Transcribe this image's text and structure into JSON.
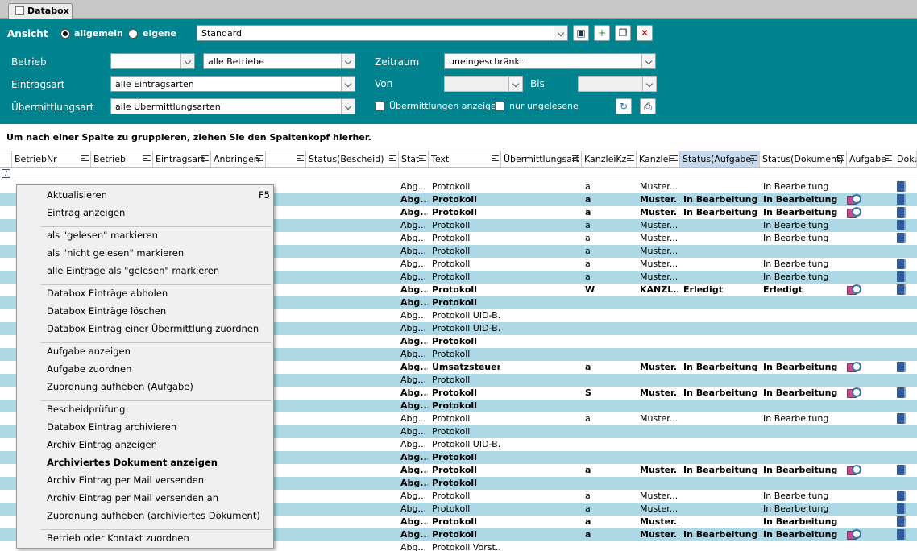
{
  "tab": {
    "title": "Databox"
  },
  "ansicht": {
    "label": "Ansicht",
    "opt1": "allgemein",
    "opt2": "eigene",
    "view": "Standard"
  },
  "filters": {
    "betrieb_label": "Betrieb",
    "betrieb_value": "",
    "betrieb_all": "alle Betriebe",
    "eintragsart_label": "Eintragsart",
    "eintragsart_value": "alle Eintragsarten",
    "uebermittlungsart_label": "Übermittlungsart",
    "uebermittlungsart_value": "alle Übermittlungsarten",
    "zeitraum_label": "Zeitraum",
    "zeitraum_value": "uneingeschränkt",
    "von_label": "Von",
    "bis_label": "Bis",
    "show_uebermittlungen": "Übermittlungen anzeigen",
    "nur_ungelesene": "nur ungelesene"
  },
  "group_hint": "Um nach einer Spalte zu gruppieren, ziehen Sie den Spaltenkopf hierher.",
  "columns": [
    "BetriebNr",
    "Betrieb",
    "Eintragsart",
    "Anbringen",
    "",
    "Status(Bescheid)",
    "Stat",
    "Text",
    "Übermittlungsart",
    "KanzleiKz",
    "Kanzlei",
    "Status(Aufgabe)",
    "Status(Dokument)",
    "Aufgabe",
    "Doku"
  ],
  "rows": [
    {
      "b": false,
      "alt": false,
      "stat": "Abg...",
      "text": "Protokoll",
      "kz": "a",
      "kanzlei": "Muster...",
      "aufg": "",
      "dok": "In Bearbeitung",
      "task": false,
      "doc": true
    },
    {
      "b": true,
      "alt": true,
      "stat": "Abg...",
      "text": "Protokoll",
      "kz": "a",
      "kanzlei": "Muster...",
      "aufg": "In Bearbeitung",
      "dok": "In Bearbeitung",
      "task": true,
      "doc": true
    },
    {
      "b": true,
      "alt": false,
      "stat": "Abg...",
      "text": "Protokoll",
      "kz": "a",
      "kanzlei": "Muster...",
      "aufg": "In Bearbeitung",
      "dok": "In Bearbeitung",
      "task": true,
      "doc": true
    },
    {
      "b": false,
      "alt": true,
      "stat": "Abg...",
      "text": "Protokoll",
      "kz": "a",
      "kanzlei": "Muster...",
      "aufg": "",
      "dok": "In Bearbeitung",
      "task": false,
      "doc": true
    },
    {
      "b": false,
      "alt": false,
      "stat": "Abg...",
      "text": "Protokoll",
      "kz": "a",
      "kanzlei": "Muster...",
      "aufg": "",
      "dok": "In Bearbeitung",
      "task": false,
      "doc": true
    },
    {
      "b": false,
      "alt": true,
      "stat": "Abg...",
      "text": "Protokoll",
      "kz": "a",
      "kanzlei": "Muster...",
      "aufg": "",
      "dok": "",
      "task": false,
      "doc": false
    },
    {
      "b": false,
      "alt": false,
      "stat": "Abg...",
      "text": "Protokoll",
      "kz": "a",
      "kanzlei": "Muster...",
      "aufg": "",
      "dok": "In Bearbeitung",
      "task": false,
      "doc": true
    },
    {
      "b": false,
      "alt": true,
      "stat": "Abg...",
      "text": "Protokoll",
      "kz": "a",
      "kanzlei": "Muster...",
      "aufg": "",
      "dok": "In Bearbeitung",
      "task": false,
      "doc": true
    },
    {
      "b": true,
      "alt": false,
      "stat": "Abg...",
      "text": "Protokoll",
      "kz": "W",
      "kanzlei": "KANZL...",
      "aufg": "Erledigt",
      "dok": "Erledigt",
      "task": true,
      "doc": true
    },
    {
      "b": true,
      "alt": true,
      "stat": "Abg...",
      "text": "Protokoll",
      "kz": "",
      "kanzlei": "",
      "aufg": "",
      "dok": "",
      "task": false,
      "doc": false
    },
    {
      "b": false,
      "alt": false,
      "stat": "Abg...",
      "text": "Protokoll UID-B...",
      "kz": "",
      "kanzlei": "",
      "aufg": "",
      "dok": "",
      "task": false,
      "doc": false
    },
    {
      "b": false,
      "alt": true,
      "stat": "Abg...",
      "text": "Protokoll UID-B...",
      "kz": "",
      "kanzlei": "",
      "aufg": "",
      "dok": "",
      "task": false,
      "doc": false
    },
    {
      "b": true,
      "alt": false,
      "stat": "Abg...",
      "text": "Protokoll",
      "kz": "",
      "kanzlei": "",
      "aufg": "",
      "dok": "",
      "task": false,
      "doc": false
    },
    {
      "b": false,
      "alt": true,
      "stat": "Abg...",
      "text": "Protokoll",
      "kz": "",
      "kanzlei": "",
      "aufg": "",
      "dok": "",
      "task": false,
      "doc": false
    },
    {
      "b": true,
      "alt": false,
      "stat": "Abg...",
      "text": "Umsatzsteuer...",
      "kz": "a",
      "kanzlei": "Muster...",
      "aufg": "In Bearbeitung",
      "dok": "In Bearbeitung",
      "task": true,
      "doc": true
    },
    {
      "b": false,
      "alt": true,
      "stat": "Abg...",
      "text": "Protokoll",
      "kz": "",
      "kanzlei": "",
      "aufg": "",
      "dok": "",
      "task": false,
      "doc": false
    },
    {
      "b": true,
      "alt": false,
      "stat": "Abg...",
      "text": "Protokoll",
      "kz": "S",
      "kanzlei": "Muster...",
      "aufg": "In Bearbeitung",
      "dok": "In Bearbeitung",
      "task": true,
      "doc": true
    },
    {
      "b": true,
      "alt": true,
      "stat": "Abg...",
      "text": "Protokoll",
      "kz": "",
      "kanzlei": "",
      "aufg": "",
      "dok": "",
      "task": false,
      "doc": false
    },
    {
      "b": false,
      "alt": false,
      "stat": "Abg...",
      "text": "Protokoll",
      "kz": "a",
      "kanzlei": "Muster...",
      "aufg": "",
      "dok": "In Bearbeitung",
      "task": false,
      "doc": true
    },
    {
      "b": false,
      "alt": true,
      "stat": "Abg...",
      "text": "Protokoll",
      "kz": "",
      "kanzlei": "",
      "aufg": "",
      "dok": "",
      "task": false,
      "doc": false
    },
    {
      "b": false,
      "alt": false,
      "stat": "Abg...",
      "text": "Protokoll UID-B...",
      "kz": "",
      "kanzlei": "",
      "aufg": "",
      "dok": "",
      "task": false,
      "doc": false
    },
    {
      "b": true,
      "alt": true,
      "stat": "Abg...",
      "text": "Protokoll",
      "kz": "",
      "kanzlei": "",
      "aufg": "",
      "dok": "",
      "task": false,
      "doc": false
    },
    {
      "b": true,
      "alt": false,
      "stat": "Abg...",
      "text": "Protokoll",
      "kz": "a",
      "kanzlei": "Muster...",
      "aufg": "In Bearbeitung",
      "dok": "In Bearbeitung",
      "task": true,
      "doc": true
    },
    {
      "b": true,
      "alt": true,
      "stat": "Abg...",
      "text": "Protokoll",
      "kz": "",
      "kanzlei": "",
      "aufg": "",
      "dok": "",
      "task": false,
      "doc": false
    },
    {
      "b": false,
      "alt": false,
      "stat": "Abg...",
      "text": "Protokoll",
      "kz": "a",
      "kanzlei": "Muster...",
      "aufg": "",
      "dok": "In Bearbeitung",
      "task": false,
      "doc": true
    },
    {
      "b": false,
      "alt": true,
      "stat": "Abg...",
      "text": "Protokoll",
      "kz": "a",
      "kanzlei": "Muster...",
      "aufg": "",
      "dok": "In Bearbeitung",
      "task": false,
      "doc": true
    },
    {
      "b": true,
      "alt": false,
      "stat": "Abg...",
      "text": "Protokoll",
      "kz": "a",
      "kanzlei": "Muster...",
      "aufg": "",
      "dok": "In Bearbeitung",
      "task": false,
      "doc": true
    },
    {
      "b": true,
      "alt": true,
      "stat": "Abg...",
      "text": "Protokoll",
      "kz": "a",
      "kanzlei": "Muster...",
      "aufg": "In Bearbeitung",
      "dok": "In Bearbeitung",
      "task": true,
      "doc": true
    },
    {
      "b": false,
      "alt": false,
      "stat": "Abg...",
      "text": "Protokoll Vorst...",
      "kz": "",
      "kanzlei": "",
      "aufg": "",
      "dok": "",
      "task": false,
      "doc": false
    }
  ],
  "context_menu": [
    {
      "label": "Aktualisieren",
      "shortcut": "F5"
    },
    {
      "label": "Eintrag anzeigen"
    },
    {
      "sep": true
    },
    {
      "label": "als \"gelesen\" markieren"
    },
    {
      "label": "als \"nicht gelesen\" markieren"
    },
    {
      "label": "alle Einträge als \"gelesen\" markieren"
    },
    {
      "sep": true
    },
    {
      "label": "Databox Einträge abholen"
    },
    {
      "label": "Databox Einträge löschen"
    },
    {
      "label": "Databox Eintrag einer Übermittlung zuordnen"
    },
    {
      "sep": true
    },
    {
      "label": "Aufgabe anzeigen"
    },
    {
      "label": "Aufgabe zuordnen"
    },
    {
      "label": "Zuordnung aufheben (Aufgabe)"
    },
    {
      "sep": true
    },
    {
      "label": "Bescheidprüfung"
    },
    {
      "label": "Databox Eintrag archivieren"
    },
    {
      "label": "Archiv Eintrag anzeigen"
    },
    {
      "label": "Archiviertes Dokument anzeigen",
      "bold": true
    },
    {
      "label": "Archiv Eintrag per Mail versenden"
    },
    {
      "label": "Archiv Eintrag per Mail versenden an"
    },
    {
      "label": "Zuordnung aufheben (archiviertes Dokument)"
    },
    {
      "sep": true
    },
    {
      "label": "Betrieb oder Kontakt zuordnen"
    }
  ]
}
